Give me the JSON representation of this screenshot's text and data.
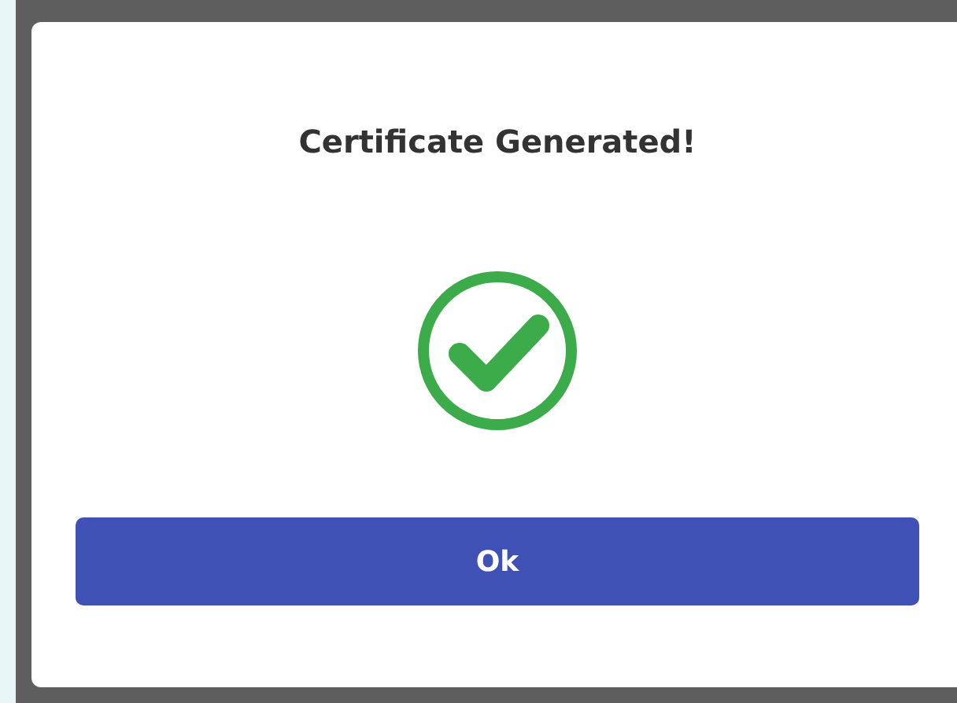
{
  "dialog": {
    "title": "Certificate Generated!",
    "kind": "success",
    "buttons": [
      "Ok"
    ]
  }
}
